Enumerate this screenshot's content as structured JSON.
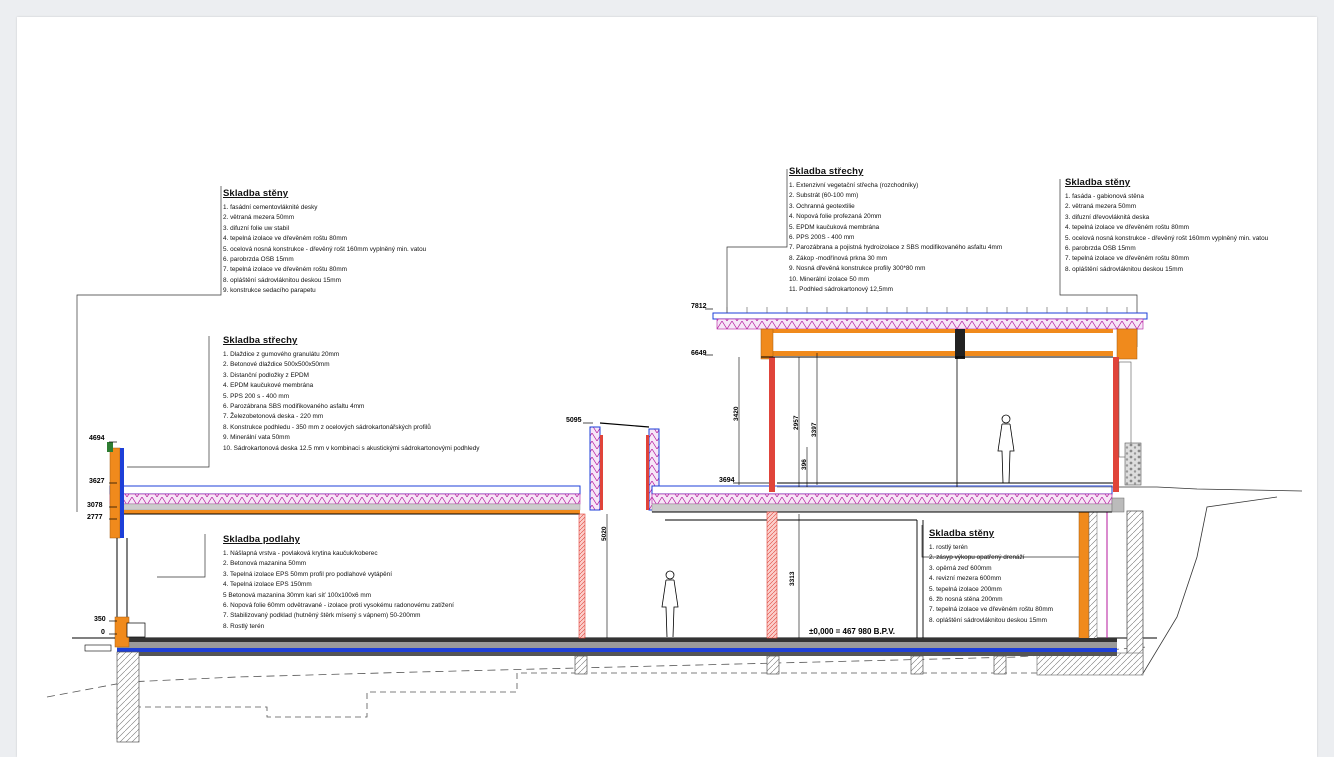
{
  "legends": [
    {
      "id": "wall-left",
      "title": "Skladba stěny",
      "items": [
        "1. fasádní cementovláknité desky",
        "2. větraná mezera 50mm",
        "3. difuzní folie uw stabil",
        "4. tepelná izolace ve dřevěném roštu 80mm",
        "5. ocelová nosná konstrukce - dřevěný rošt 160mm vyplněný min. vatou",
        "6. parobrzda OSB 15mm",
        "7. tepelná izolace ve dřevěném roštu 80mm",
        "8. opláštění sádrovláknitou deskou 15mm",
        "9. konstrukce sedacího parapetu"
      ]
    },
    {
      "id": "roof-left",
      "title": "Skladba střechy",
      "items": [
        "1. Dlaždice z gumového granulátu 20mm",
        "2. Betonové dlaždice 500x500x50mm",
        "3. Distanční podložky z EPDM",
        "4. EPDM kaučukové membrána",
        "5. PPS 200 s - 400 mm",
        "6. Parozábrana SBS modifikovaného asfaltu 4mm",
        "7. Železobetonová deska - 220 mm",
        "8. Konstrukce podhledu - 350 mm z ocelových sádrokartonářských profilů",
        "9. Minerální vata 50mm",
        "10. Sádrokartonová deska 12.5 mm v kombinaci s akustickými sádrokartonovými podhledy"
      ]
    },
    {
      "id": "floor",
      "title": "Skladba podlahy",
      "items": [
        "1. Nášlapná vrstva - povlaková krytina kaučuk/koberec",
        "2. Betonová mazanina 50mm",
        "3. Tepelná izolace EPS 50mm profil pro podlahové vytápění",
        "4. Tepelná izolace EPS 150mm",
        "5 Betonová mazanina 30mm kari síť 100x100x6 mm",
        "6. Nopová folie 60mm odvětravané - izolace proti vysokému radonovému zatížení",
        "7. Stabilizovaný podklad (hutněný štěrk mísený s vápnem) 50-200mm",
        "8. Rostlý terén"
      ]
    },
    {
      "id": "roof-right",
      "title": "Skladba střechy",
      "items": [
        "1. Extenzivní vegetační střecha (rozchodníky)",
        "2. Substrát (60-100 mm)",
        "3. Ochranná geotextilie",
        "4. Nopová folie profezaná 20mm",
        "5. EPDM kaučuková membrána",
        "6. PPS 200S - 400 mm",
        "7. Parozábrana a pojistná hydroizolace z SBS modifikovaného asfaltu 4mm",
        "8. Zákop -modřínová prkna 30 mm",
        "9. Nosná dřevěná konstrukce profily 300*80 mm",
        "10. Minerální izolace 50 mm",
        "11. Podhled sádrokartonový 12,5mm"
      ]
    },
    {
      "id": "wall-right",
      "title": "Skladba stěny",
      "items": [
        "1. fasáda - gabionová stěna",
        "2. větraná mezera 50mm",
        "3. difuzní dřevovláknitá deska",
        "4. tepelná izolace ve dřevěném roštu 80mm",
        "5. ocelová nosná konstrukce - dřevěný rošt 160mm vyplněný min. vatou",
        "6. parobrzda OSB 15mm",
        "7. tepelná izolace ve dřevěném roštu 80mm",
        "8. opláštění sádrovláknitou deskou 15mm"
      ]
    },
    {
      "id": "wall-basement",
      "title": "Skladba stěny",
      "items": [
        "1. rostlý terén",
        "2. zásyp výkopu opatřený drenáží",
        "3. opěrná zeď 600mm",
        "4. revizní mezera 600mm",
        "5. tepelná izolace 200mm",
        "6. žb nosná stěna 200mm",
        "7. tepelná izolace ve dřevěném roštu 80mm",
        "8. opláštění sádrovláknitou deskou 15mm"
      ]
    }
  ],
  "levels": {
    "l4694": "4694",
    "l3627": "3627",
    "l3078": "3078",
    "l2777": "2777",
    "l350": "350",
    "l0": "0",
    "l5095": "5095",
    "l7812": "7812",
    "l6649": "6649",
    "l3694": "3694"
  },
  "dimensions": {
    "d3420": "3420",
    "d2957": "2957",
    "d3397": "3397",
    "d396": "396",
    "d5020": "5020",
    "d3313": "3313"
  },
  "datum": "±0,000 = 467 980 B.P.V.",
  "colors": {
    "insulation": "#b5179e",
    "waterproof": "#1d3fd8",
    "timber": "#f08a1c",
    "steel": "#e0443a",
    "concrete": "#9a9a9a"
  }
}
